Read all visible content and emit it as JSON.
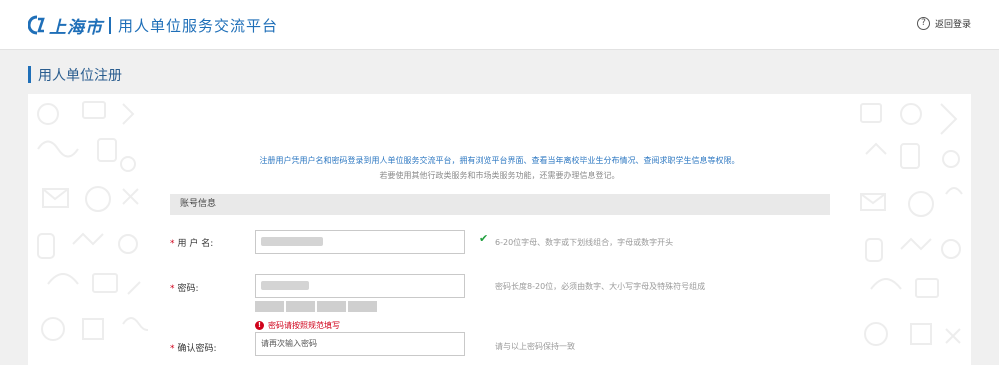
{
  "header": {
    "city": "上海市",
    "title": "用人单位服务交流平台",
    "back_login": "返回登录",
    "help_icon": "?"
  },
  "page": {
    "title": "用人单位注册"
  },
  "intro": {
    "line1": "注册用户凭用户名和密码登录到用人单位服务交流平台，拥有浏览平台界面、查看当年离校毕业生分布情况、查阅求职学生信息等权限。",
    "line2": "若要使用其他行政类服务和市场类服务功能，还需要办理信息登记。"
  },
  "form": {
    "section_title": "账号信息",
    "required_mark": "*",
    "username": {
      "label": "用 户 名:",
      "hint": "6-20位字母、数字或下划线组合，字母或数字开头",
      "valid_icon": "✔"
    },
    "password": {
      "label": "密码:",
      "hint": "密码长度8-20位，必须由数字、大小写字母及特殊符号组成",
      "error": "密码请按照规范填写",
      "error_icon": "!"
    },
    "confirm": {
      "label": "确认密码:",
      "placeholder": "请再次输入密码",
      "hint": "请与以上密码保持一致"
    }
  },
  "colors": {
    "brand": "#1f6fb8",
    "error": "#d0021b",
    "success": "#1e9e3c"
  }
}
